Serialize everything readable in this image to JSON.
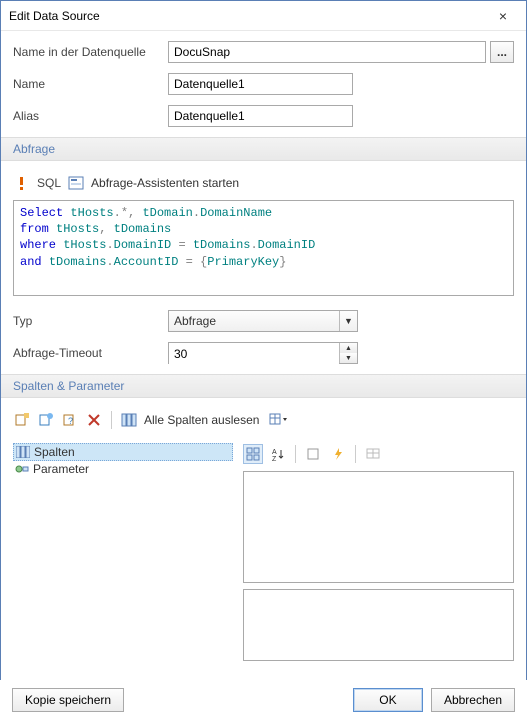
{
  "window": {
    "title": "Edit Data Source",
    "close": "×"
  },
  "form": {
    "name_in_ds_label": "Name in der Datenquelle",
    "name_in_ds_value": "DocuSnap",
    "ellipsis": "...",
    "name_label": "Name",
    "name_value": "Datenquelle1",
    "alias_label": "Alias",
    "alias_value": "Datenquelle1"
  },
  "query_section": {
    "header": "Abfrage",
    "sql_label": "SQL",
    "wizard_label": "Abfrage-Assistenten starten",
    "sql_tokens": [
      {
        "t": "Select",
        "c": "kw"
      },
      {
        "t": " ",
        "c": ""
      },
      {
        "t": "tHosts",
        "c": "ident"
      },
      {
        "t": ".*, ",
        "c": "op"
      },
      {
        "t": "tDomain",
        "c": "ident"
      },
      {
        "t": ".",
        "c": "op"
      },
      {
        "t": "DomainName",
        "c": "ident"
      },
      {
        "t": "\n",
        "c": ""
      },
      {
        "t": "from",
        "c": "kw"
      },
      {
        "t": " ",
        "c": ""
      },
      {
        "t": "tHosts",
        "c": "ident"
      },
      {
        "t": ", ",
        "c": "op"
      },
      {
        "t": "tDomains",
        "c": "ident"
      },
      {
        "t": "\n",
        "c": ""
      },
      {
        "t": "where",
        "c": "kw"
      },
      {
        "t": " ",
        "c": ""
      },
      {
        "t": "tHosts",
        "c": "ident"
      },
      {
        "t": ".",
        "c": "op"
      },
      {
        "t": "DomainID",
        "c": "ident"
      },
      {
        "t": " = ",
        "c": "op"
      },
      {
        "t": "tDomains",
        "c": "ident"
      },
      {
        "t": ".",
        "c": "op"
      },
      {
        "t": "DomainID",
        "c": "ident"
      },
      {
        "t": "\n",
        "c": ""
      },
      {
        "t": "and",
        "c": "kw"
      },
      {
        "t": " ",
        "c": ""
      },
      {
        "t": "tDomains",
        "c": "ident"
      },
      {
        "t": ".",
        "c": "op"
      },
      {
        "t": "AccountID",
        "c": "ident"
      },
      {
        "t": " = {",
        "c": "op"
      },
      {
        "t": "PrimaryKey",
        "c": "ident"
      },
      {
        "t": "}",
        "c": "op"
      }
    ],
    "type_label": "Typ",
    "type_value": "Abfrage",
    "timeout_label": "Abfrage-Timeout",
    "timeout_value": "30"
  },
  "columns_section": {
    "header": "Spalten & Parameter",
    "read_all_label": "Alle Spalten auslesen",
    "tree": {
      "spalten": "Spalten",
      "parameter": "Parameter"
    }
  },
  "footer": {
    "save_copy": "Kopie speichern",
    "ok": "OK",
    "cancel": "Abbrechen"
  }
}
